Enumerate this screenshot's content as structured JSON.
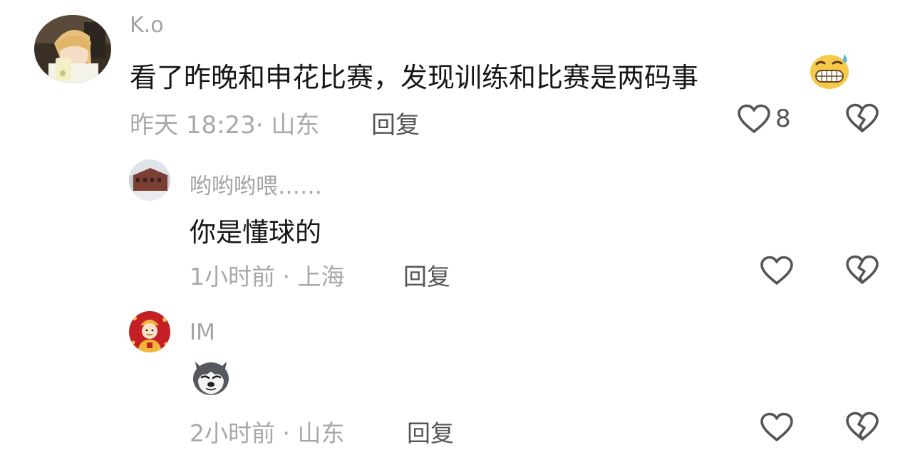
{
  "comments": [
    {
      "username": "K.o",
      "text": "看了昨晚和申花比赛，发现训练和比赛是两码事",
      "emoji": "grinning-sweat-emoji",
      "time": "昨天 18:23",
      "location": "山东",
      "meta": "昨天 18:23· 山东",
      "reply_label": "回复",
      "like_count": "8"
    },
    {
      "username": "哟哟哟喂……",
      "text": "你是懂球的",
      "time": "1小时前",
      "location": "上海",
      "meta": "1小时前 · 上海",
      "reply_label": "回复"
    },
    {
      "username": "IM",
      "sticker": "husky-dog-sticker",
      "time": "2小时前",
      "location": "山东",
      "meta": "2小时前 · 山东",
      "reply_label": "回复"
    }
  ],
  "icons": {
    "like": "heart-outline-icon",
    "dislike": "broken-heart-icon"
  },
  "colors": {
    "username": "#a3a3a3",
    "text": "#161616",
    "meta": "#a8a8a8",
    "action": "#555555",
    "icon": "#555555"
  }
}
